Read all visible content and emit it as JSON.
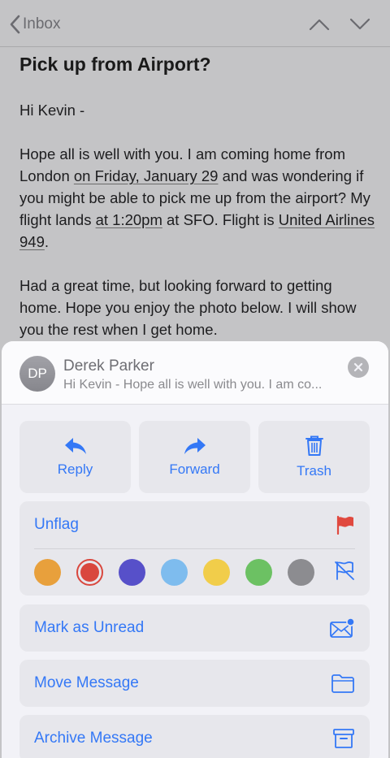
{
  "nav": {
    "back_label": "Inbox"
  },
  "email": {
    "subject": "Pick up from Airport?",
    "greeting": "Hi Kevin -",
    "p1_a": "Hope all is well with you. I am coming home from London ",
    "p1_date": "on Friday, January 29",
    "p1_b": " and was wondering if you might be able to pick me up from the airport? My flight lands ",
    "p1_time": "at 1:20pm",
    "p1_c": " at SFO. Flight is ",
    "p1_flight": "United Airlines 949",
    "p1_d": ".",
    "p2": "Had a great time, but looking forward to getting home. Hope you enjoy the photo below. I will show you the rest when I get home."
  },
  "sheet": {
    "avatar_initials": "DP",
    "sender": "Derek Parker",
    "preview": "Hi Kevin - Hope all is well with you. I am co...",
    "actions": {
      "reply": "Reply",
      "forward": "Forward",
      "trash": "Trash"
    },
    "unflag": "Unflag",
    "flag_colors": [
      "#e8a03c",
      "#d9473e",
      "#5750c9",
      "#7ebcee",
      "#f1cd4a",
      "#6cc163",
      "#8c8c90"
    ],
    "selected_flag_color": "#d9473e",
    "mark_unread": "Mark as Unread",
    "move_message": "Move Message",
    "archive_message": "Archive Message"
  },
  "colors": {
    "accent": "#3478f6",
    "flag_red": "#e0493f"
  }
}
